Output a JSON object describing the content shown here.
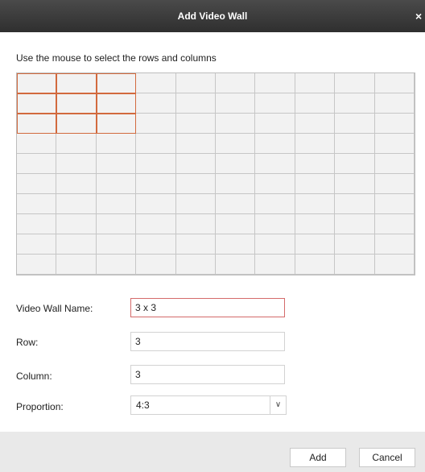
{
  "dialog": {
    "title": "Add Video Wall",
    "close_glyph": "×"
  },
  "grid": {
    "instruction": "Use the mouse to select the rows and columns",
    "rows": 10,
    "columns": 10,
    "selected_rows": 3,
    "selected_columns": 3,
    "selection_color": "#d26a3e"
  },
  "form": {
    "name_label": "Video Wall Name:",
    "name_value": "3 x 3",
    "row_label": "Row:",
    "row_value": "3",
    "column_label": "Column:",
    "column_value": "3",
    "proportion_label": "Proportion:",
    "proportion_value": "4:3",
    "dropdown_icon": "chevron-down-icon"
  },
  "buttons": {
    "add": "Add",
    "cancel": "Cancel"
  }
}
